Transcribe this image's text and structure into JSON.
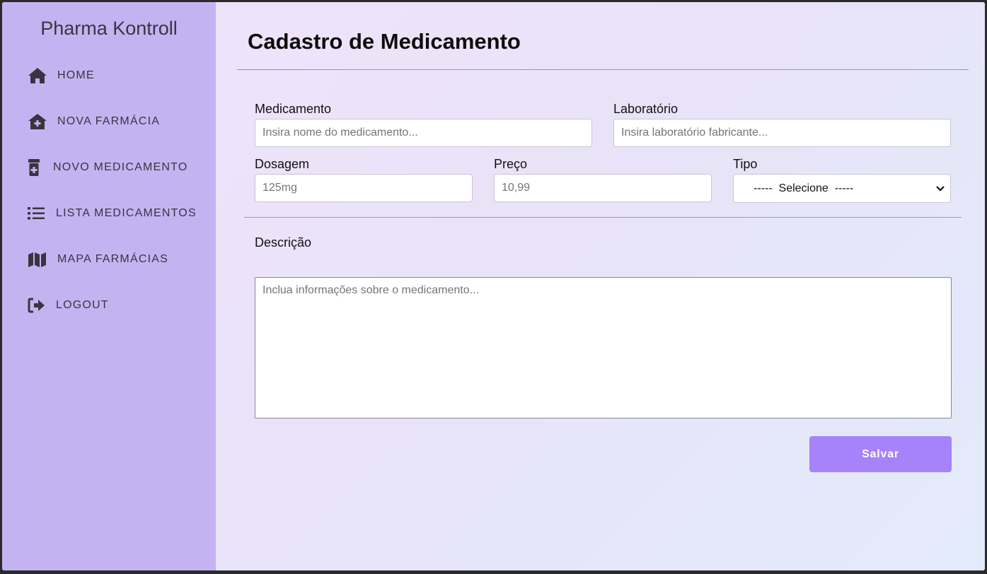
{
  "sidebar": {
    "brand": "Pharma Kontroll",
    "items": [
      {
        "label": "HOME",
        "icon": "home-icon"
      },
      {
        "label": "NOVA FARMÁCIA",
        "icon": "house-medical-icon"
      },
      {
        "label": "NOVO MEDICAMENTO",
        "icon": "prescription-bottle-icon"
      },
      {
        "label": "LISTA MEDICAMENTOS",
        "icon": "list-icon"
      },
      {
        "label": "MAPA FARMÁCIAS",
        "icon": "map-icon"
      },
      {
        "label": "LOGOUT",
        "icon": "logout-icon"
      }
    ]
  },
  "form": {
    "title": "Cadastro de Medicamento",
    "medicamento": {
      "label": "Medicamento",
      "placeholder": "Insira nome do medicamento..."
    },
    "laboratorio": {
      "label": "Laboratório",
      "placeholder": "Insira laboratório fabricante..."
    },
    "dosagem": {
      "label": "Dosagem",
      "placeholder": "125mg"
    },
    "preco": {
      "label": "Preço",
      "placeholder": "10,99"
    },
    "tipo": {
      "label": "Tipo",
      "selected": "-----  Selecione  -----"
    },
    "descricao": {
      "label": "Descrição",
      "placeholder": "Inclua informações sobre o medicamento..."
    },
    "save_label": "Salvar"
  },
  "colors": {
    "sidebar_bg": "#c5b3f1",
    "accent": "#a682fb"
  }
}
